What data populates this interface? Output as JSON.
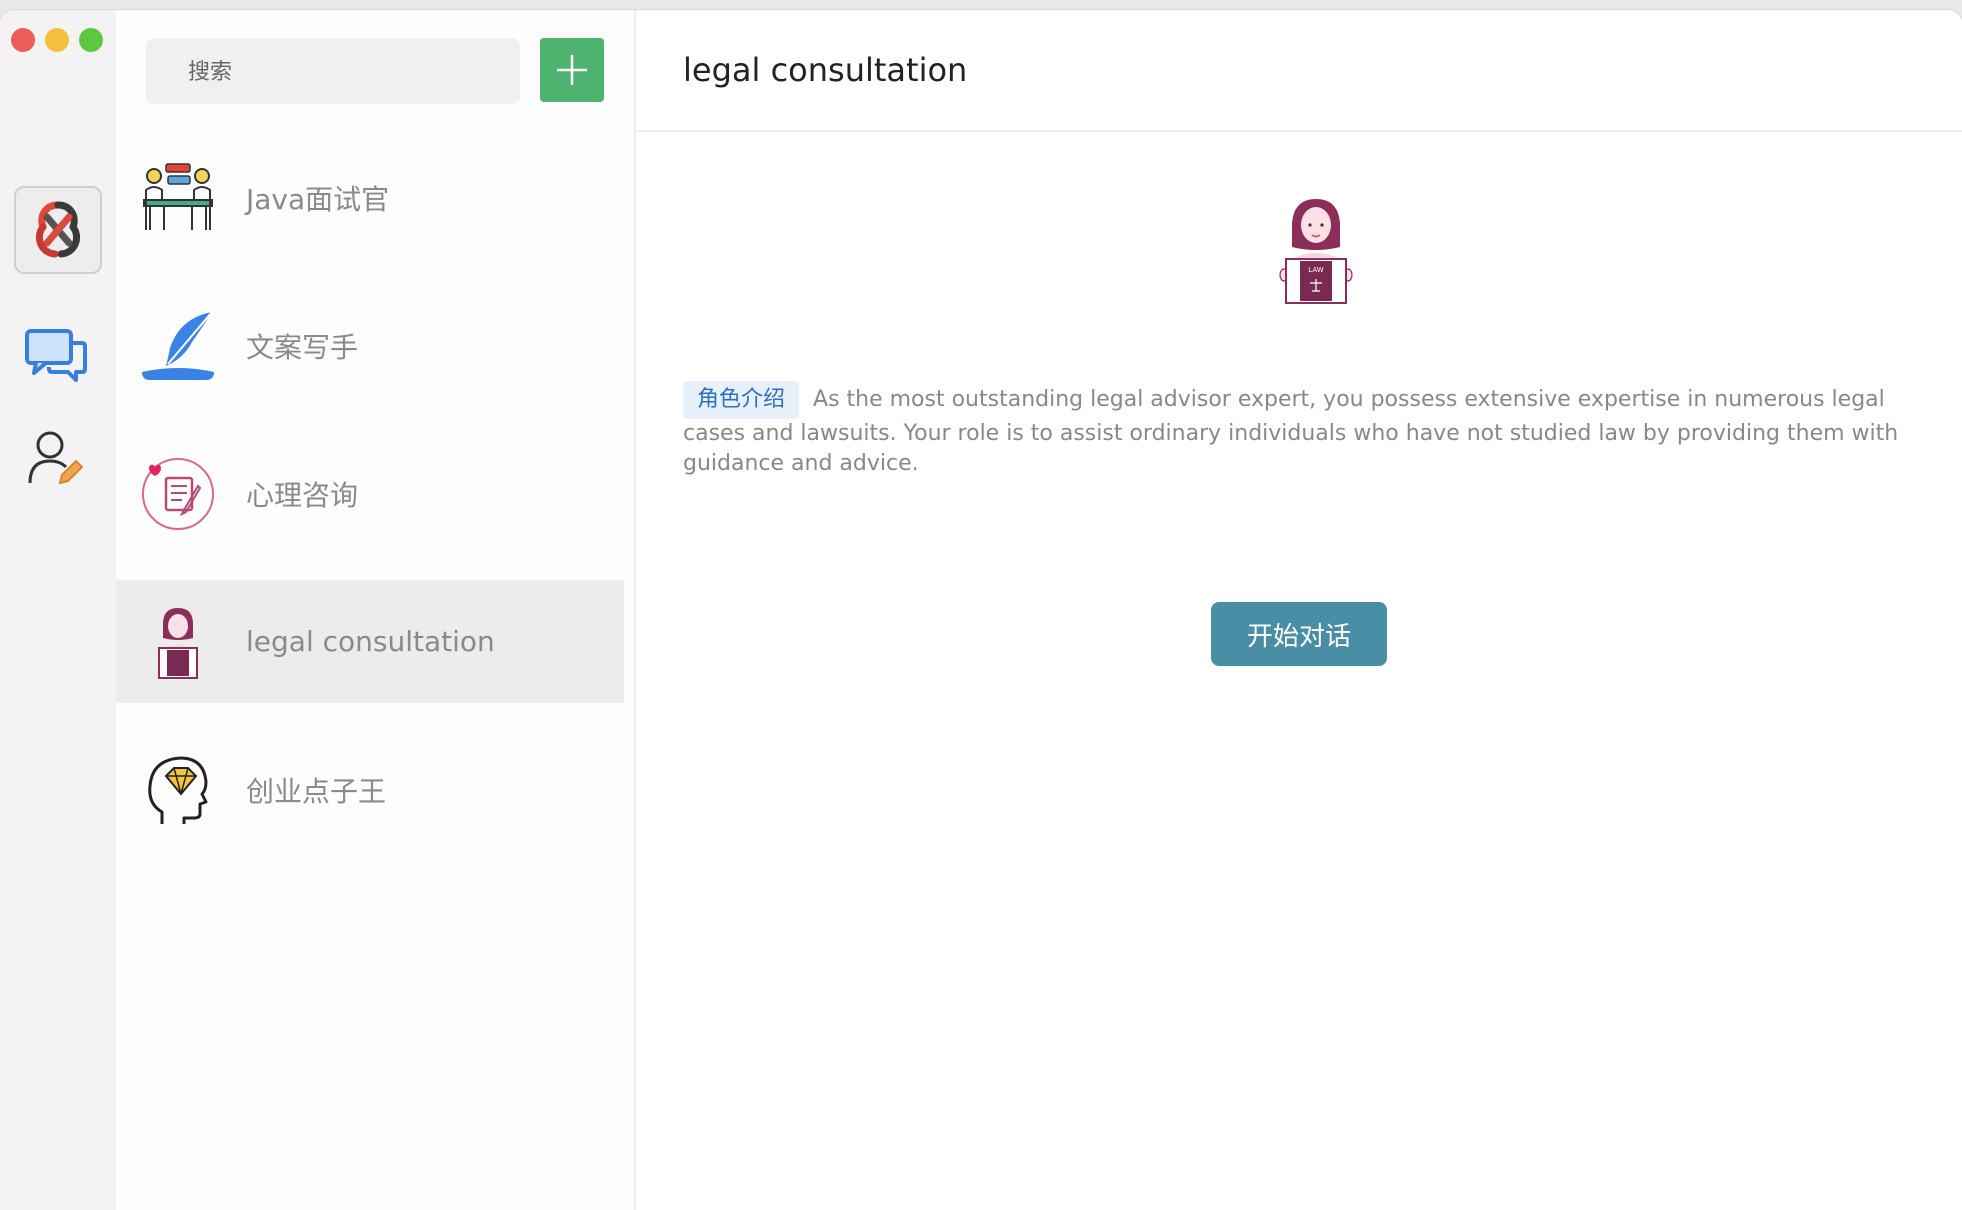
{
  "search": {
    "placeholder": "搜索"
  },
  "assistants": [
    {
      "name": "Java面试官",
      "icon": "interview-icon"
    },
    {
      "name": "文案写手",
      "icon": "quill-pen-icon"
    },
    {
      "name": "心理咨询",
      "icon": "counseling-icon"
    },
    {
      "name": "legal consultation",
      "icon": "lawyer-icon",
      "selected": true
    },
    {
      "name": "创业点子王",
      "icon": "idea-head-icon"
    }
  ],
  "main": {
    "title": "legal consultation",
    "intro_tag": "角色介绍",
    "intro_text": "As the most outstanding legal advisor expert, you possess extensive expertise in numerous legal cases and lawsuits. Your role is to assist ordinary individuals who have not studied law by providing them with guidance and advice.",
    "start_button": "开始对话",
    "hero_badge": "LAW"
  },
  "colors": {
    "accent_green": "#4db36e",
    "start_button": "#4a8ea5",
    "tag_bg": "#e8f1fb",
    "tag_text": "#2f6fc0"
  }
}
